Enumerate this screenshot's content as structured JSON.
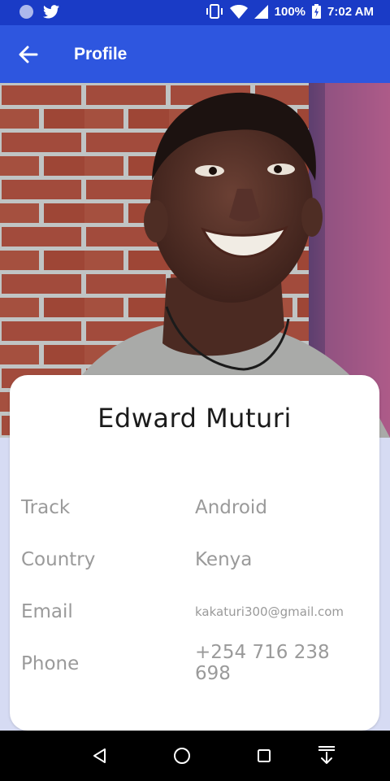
{
  "status_bar": {
    "battery": "100%",
    "time": "7:02 AM",
    "icons": [
      "notification-dot-icon",
      "twitter-icon",
      "vibrate-icon",
      "wifi-icon",
      "cell-signal-icon",
      "battery-charging-icon"
    ]
  },
  "app_bar": {
    "title": "Profile",
    "back_icon": "arrow-left-icon"
  },
  "profile": {
    "name": "Edward Muturi",
    "fields": [
      {
        "label": "Track",
        "value": "Android"
      },
      {
        "label": "Country",
        "value": "Kenya"
      },
      {
        "label": "Email",
        "value": "kakaturi300@gmail.com"
      },
      {
        "label": "Phone",
        "value": "+254 716 238 698"
      }
    ]
  },
  "nav_bar": {
    "icons": [
      "back-triangle-icon",
      "home-circle-icon",
      "recents-square-icon",
      "download-arrow-icon"
    ]
  },
  "colors": {
    "status_bar": "#1a3bc6",
    "app_bar": "#2e56df",
    "background": "#d6dbf3",
    "card": "#ffffff",
    "muted_text": "#9a9a9a"
  }
}
